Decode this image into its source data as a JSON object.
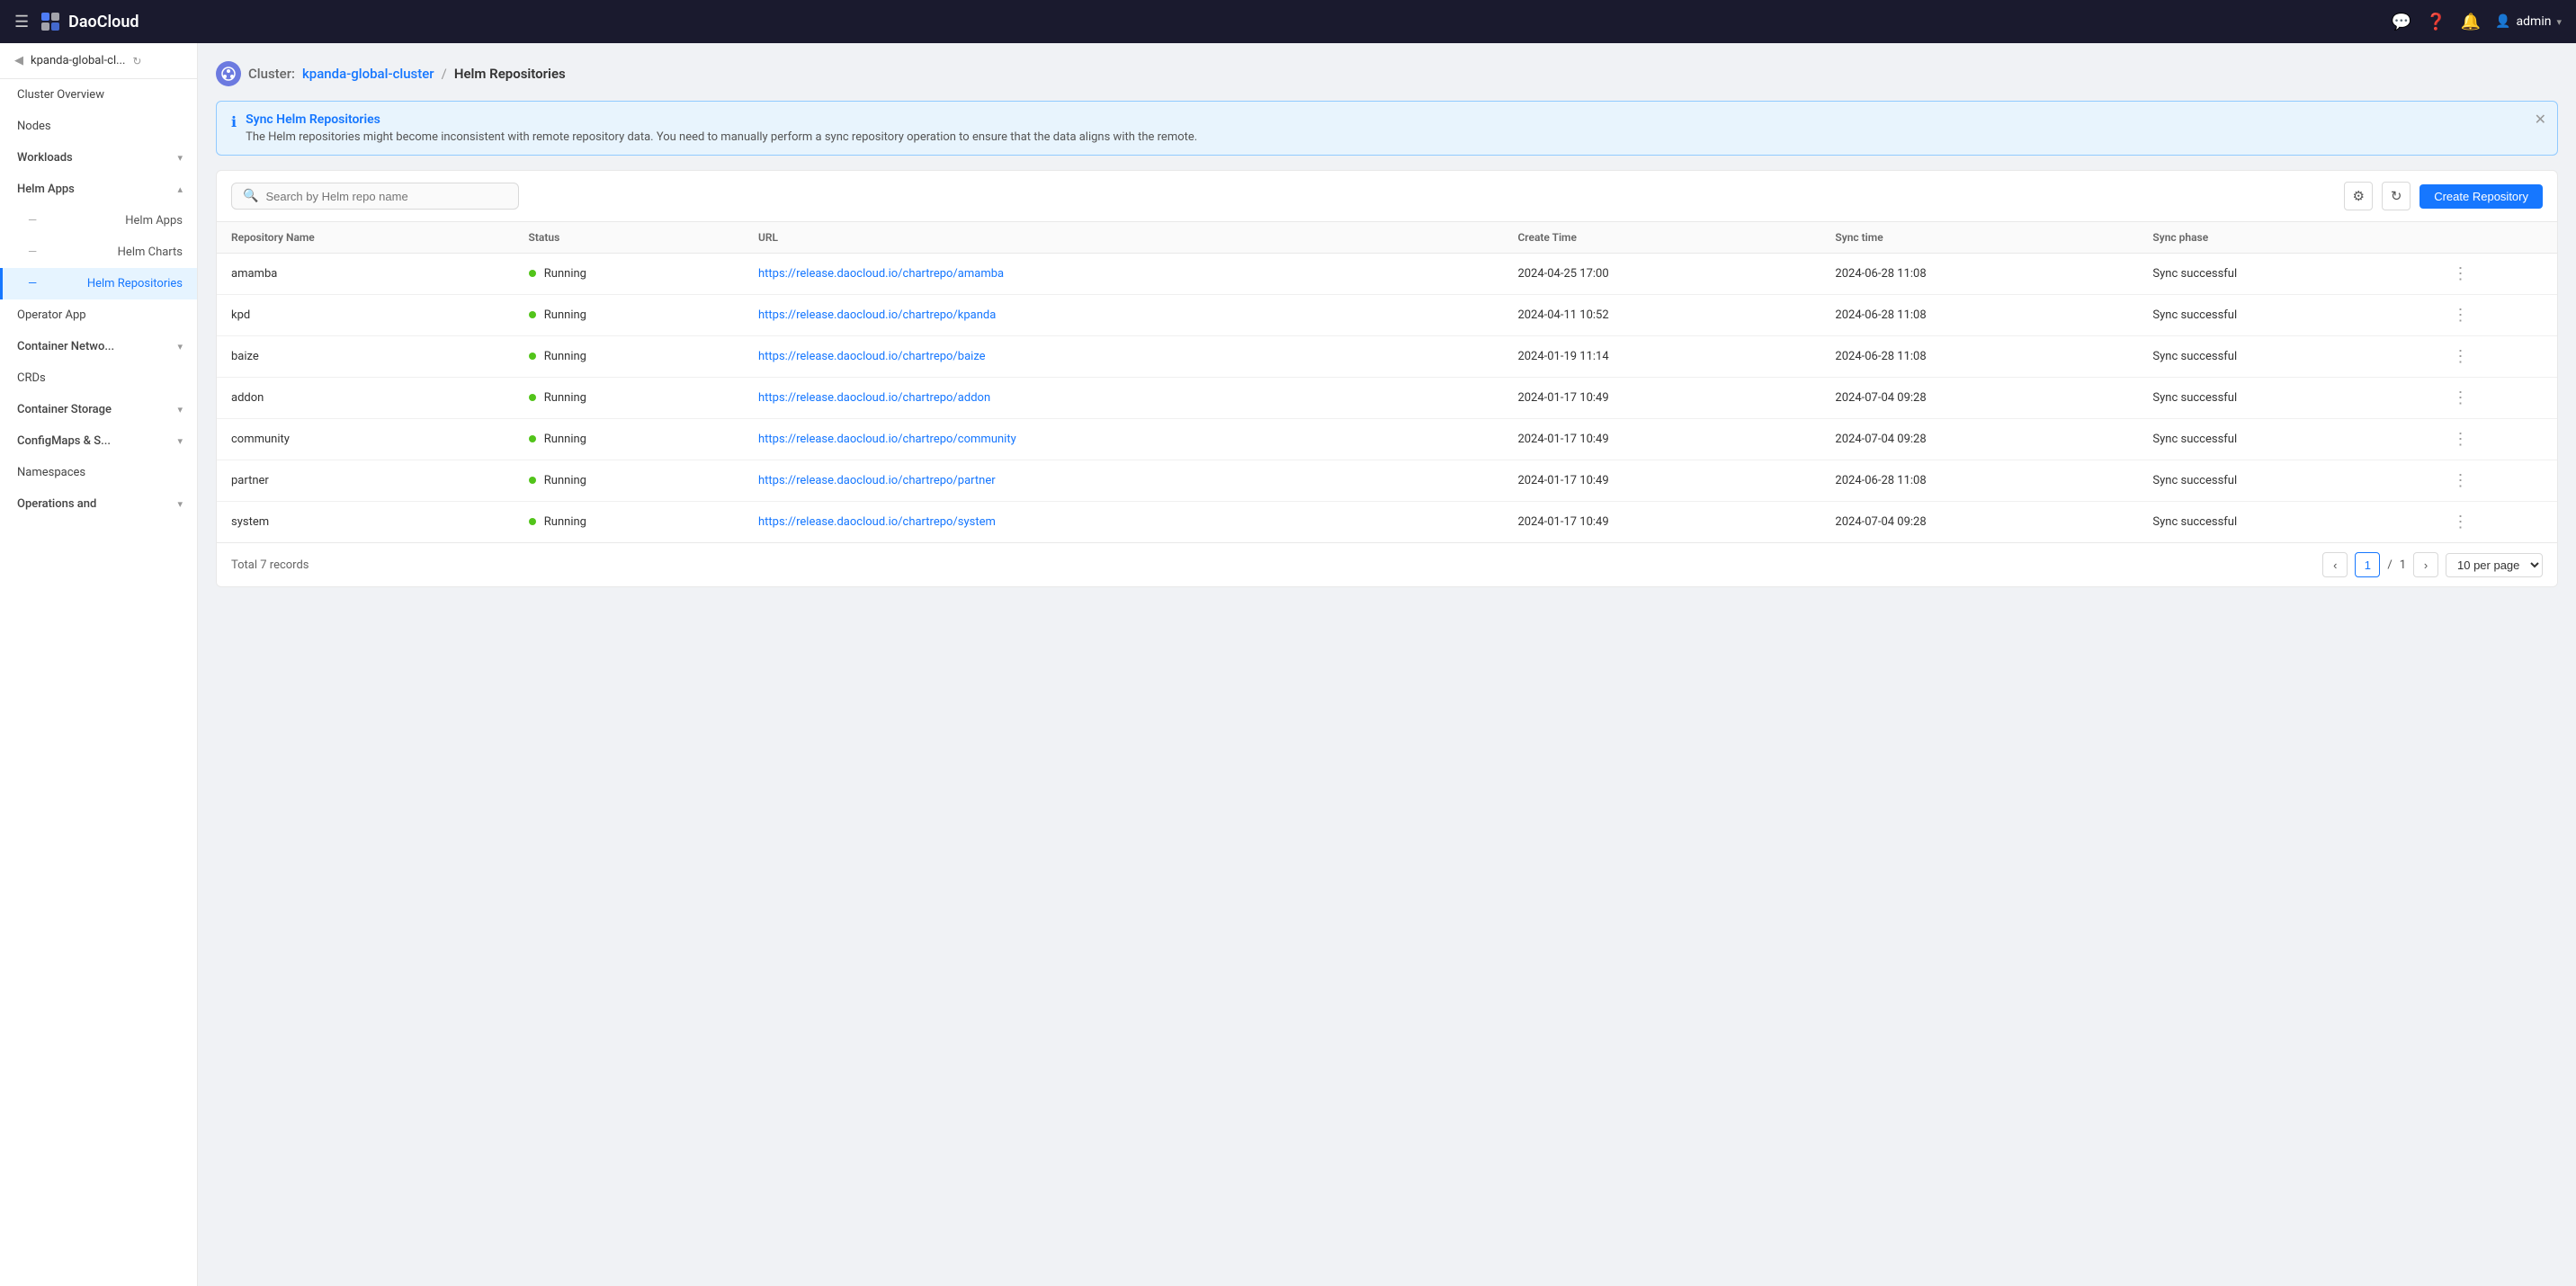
{
  "topnav": {
    "logo_text": "DaoCloud",
    "user_label": "admin"
  },
  "sidebar": {
    "cluster_name": "kpanda-global-cl...",
    "items": [
      {
        "id": "cluster-overview",
        "label": "Cluster Overview",
        "type": "link",
        "indent": 0
      },
      {
        "id": "nodes",
        "label": "Nodes",
        "type": "link",
        "indent": 0
      },
      {
        "id": "workloads",
        "label": "Workloads",
        "type": "section",
        "indent": 0,
        "expanded": false
      },
      {
        "id": "helm-apps",
        "label": "Helm Apps",
        "type": "section",
        "indent": 0,
        "expanded": true
      },
      {
        "id": "helm-apps-sub",
        "label": "Helm Apps",
        "type": "sub",
        "indent": 1
      },
      {
        "id": "helm-charts-sub",
        "label": "Helm Charts",
        "type": "sub",
        "indent": 1
      },
      {
        "id": "helm-repositories-sub",
        "label": "Helm Repositories",
        "type": "sub",
        "indent": 1,
        "active": true
      },
      {
        "id": "operator-app",
        "label": "Operator App",
        "type": "link",
        "indent": 0
      },
      {
        "id": "container-network",
        "label": "Container Netwo...",
        "type": "section",
        "indent": 0,
        "expanded": false
      },
      {
        "id": "crds",
        "label": "CRDs",
        "type": "link",
        "indent": 0
      },
      {
        "id": "container-storage",
        "label": "Container Storage",
        "type": "section",
        "indent": 0,
        "expanded": false
      },
      {
        "id": "configmaps",
        "label": "ConfigMaps & S...",
        "type": "section",
        "indent": 0,
        "expanded": false
      },
      {
        "id": "namespaces",
        "label": "Namespaces",
        "type": "link",
        "indent": 0
      },
      {
        "id": "operations",
        "label": "Operations and",
        "type": "section",
        "indent": 0,
        "expanded": false
      }
    ]
  },
  "breadcrumb": {
    "cluster_label": "Cluster:",
    "cluster_name": "kpanda-global-cluster",
    "separator": "/",
    "current_page": "Helm Repositories"
  },
  "alert": {
    "title": "Sync Helm Repositories",
    "text": "The Helm repositories might become inconsistent with remote repository data. You need to manually perform a sync repository operation to ensure that the data aligns with the remote."
  },
  "toolbar": {
    "search_placeholder": "Search by Helm repo name",
    "create_button_label": "Create Repository"
  },
  "table": {
    "columns": [
      "Repository Name",
      "Status",
      "URL",
      "Create Time",
      "Sync time",
      "Sync phase"
    ],
    "rows": [
      {
        "name": "amamba",
        "status": "Running",
        "url": "https://release.daocloud.io/chartrepo/amamba",
        "create_time": "2024-04-25 17:00",
        "sync_time": "2024-06-28 11:08",
        "sync_phase": "Sync successful"
      },
      {
        "name": "kpd",
        "status": "Running",
        "url": "https://release.daocloud.io/chartrepo/kpanda",
        "create_time": "2024-04-11 10:52",
        "sync_time": "2024-06-28 11:08",
        "sync_phase": "Sync successful"
      },
      {
        "name": "baize",
        "status": "Running",
        "url": "https://release.daocloud.io/chartrepo/baize",
        "create_time": "2024-01-19 11:14",
        "sync_time": "2024-06-28 11:08",
        "sync_phase": "Sync successful"
      },
      {
        "name": "addon",
        "status": "Running",
        "url": "https://release.daocloud.io/chartrepo/addon",
        "create_time": "2024-01-17 10:49",
        "sync_time": "2024-07-04 09:28",
        "sync_phase": "Sync successful"
      },
      {
        "name": "community",
        "status": "Running",
        "url": "https://release.daocloud.io/chartrepo/community",
        "create_time": "2024-01-17 10:49",
        "sync_time": "2024-07-04 09:28",
        "sync_phase": "Sync successful"
      },
      {
        "name": "partner",
        "status": "Running",
        "url": "https://release.daocloud.io/chartrepo/partner",
        "create_time": "2024-01-17 10:49",
        "sync_time": "2024-06-28 11:08",
        "sync_phase": "Sync successful"
      },
      {
        "name": "system",
        "status": "Running",
        "url": "https://release.daocloud.io/chartrepo/system",
        "create_time": "2024-01-17 10:49",
        "sync_time": "2024-07-04 09:28",
        "sync_phase": "Sync successful"
      }
    ],
    "total_label": "Total 7 records"
  },
  "pagination": {
    "current_page": "1",
    "total_pages": "1",
    "per_page_label": "10 per page"
  }
}
